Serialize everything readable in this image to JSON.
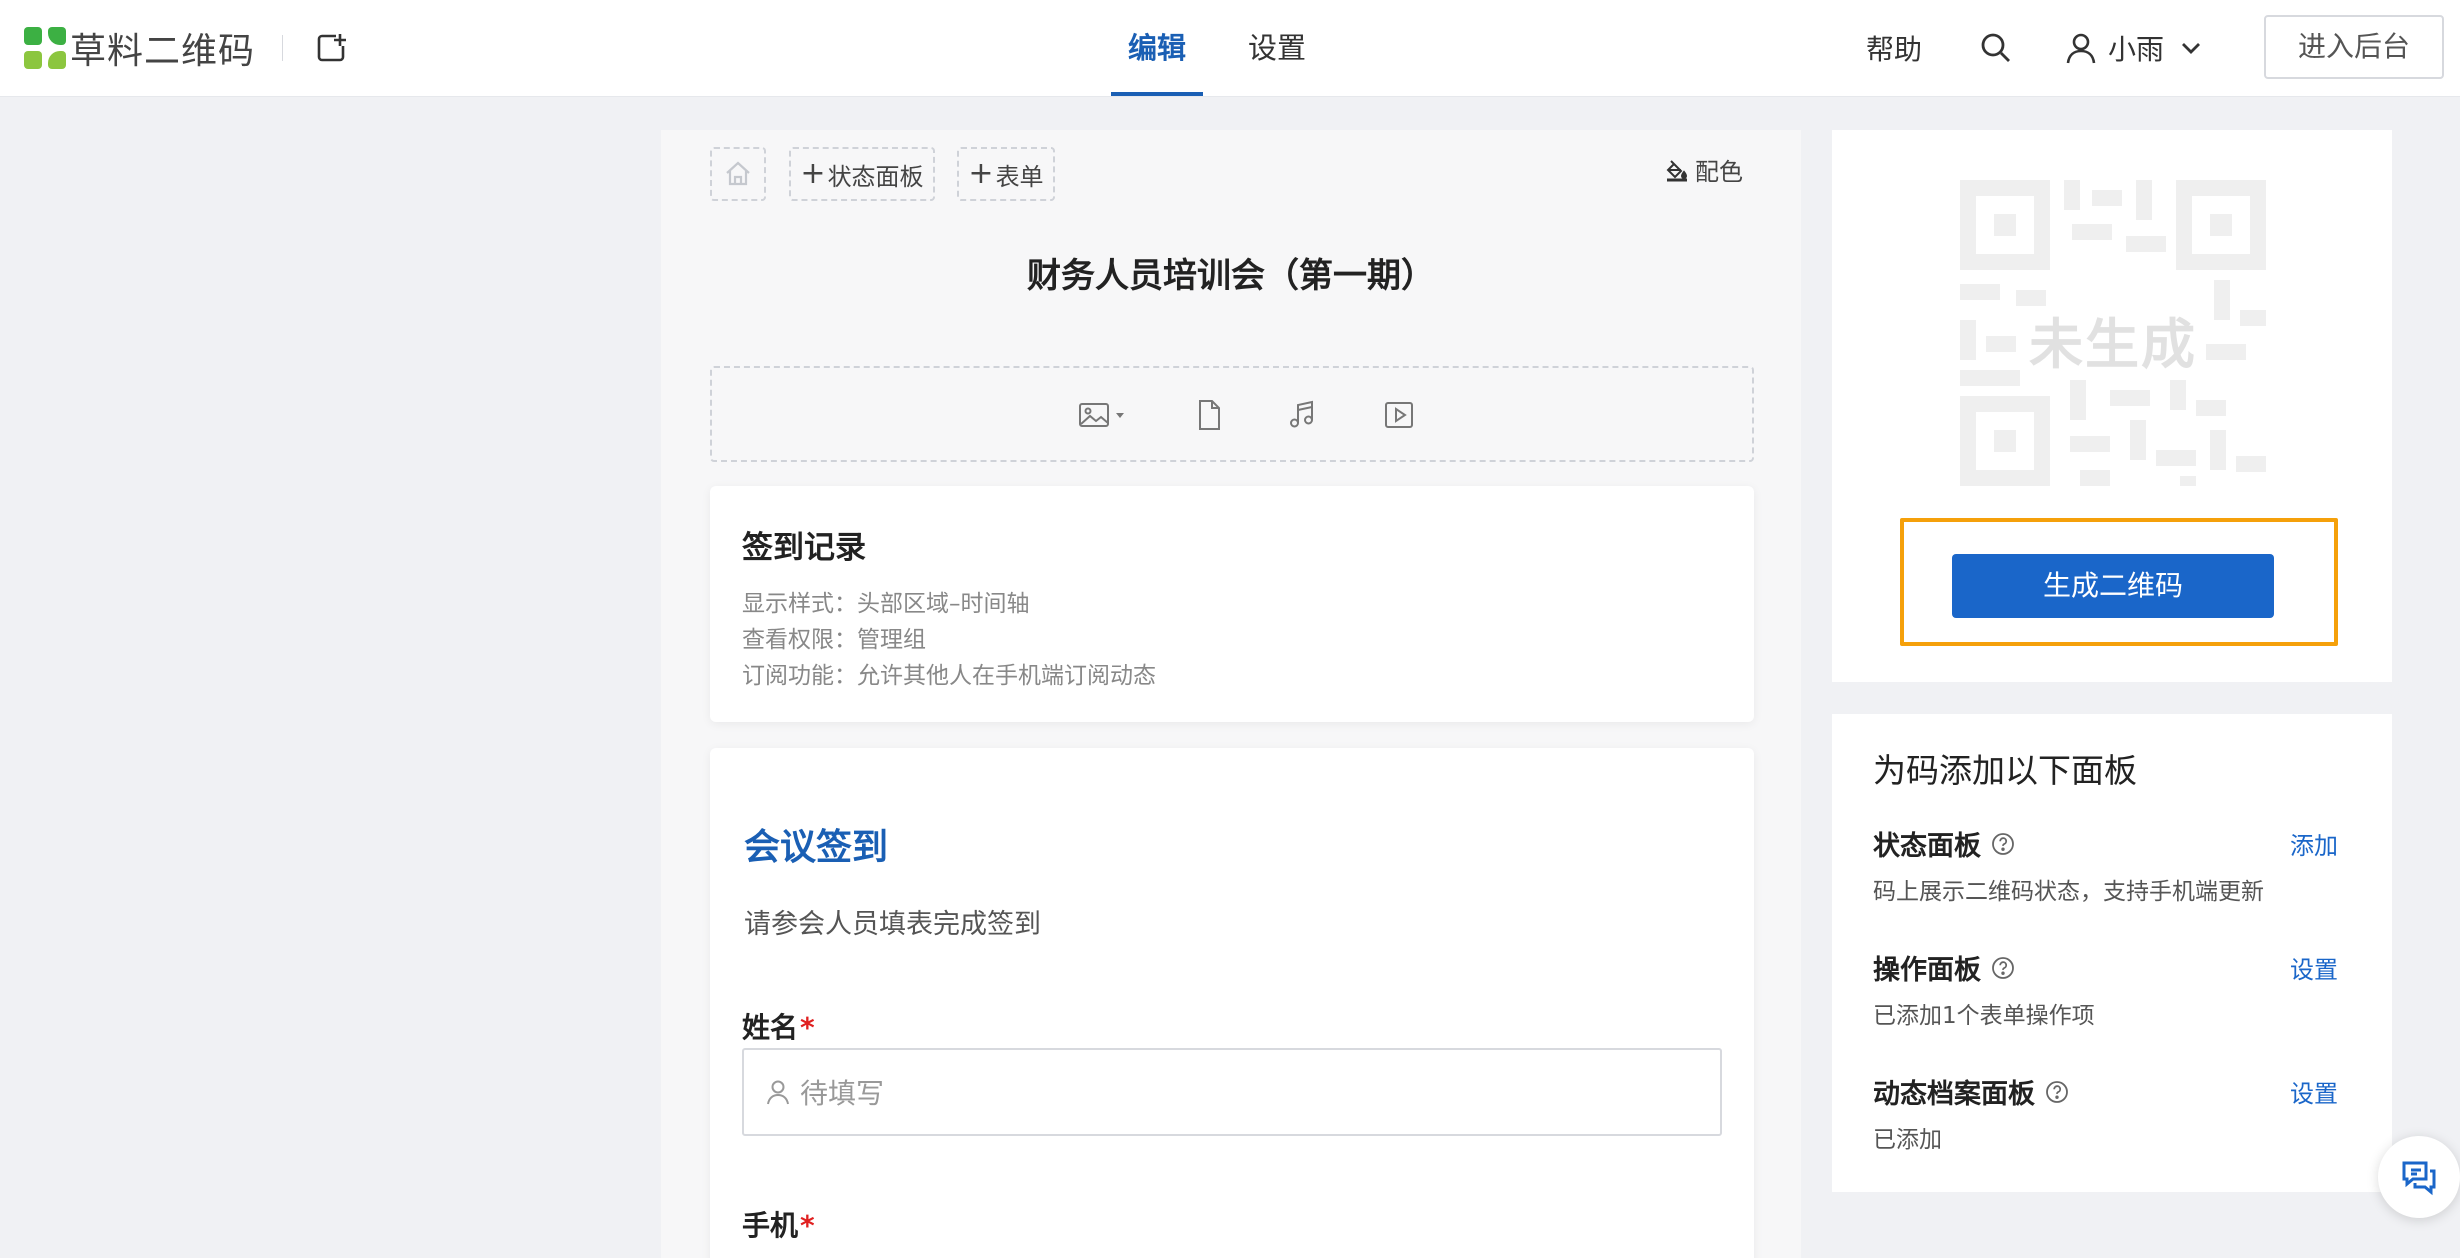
{
  "brand": {
    "name": "草料二维码"
  },
  "nav": {
    "tabs": [
      {
        "label": "编辑",
        "active": true
      },
      {
        "label": "设置",
        "active": false
      }
    ]
  },
  "header": {
    "help": "帮助",
    "user_name": "小雨",
    "backend_button": "进入后台"
  },
  "editor": {
    "chips": {
      "status_panel": "状态面板",
      "form": "表单"
    },
    "palette_label": "配色",
    "title": "财务人员培训会（第一期）",
    "media_icons": [
      "image-icon",
      "file-icon",
      "music-icon",
      "video-icon"
    ],
    "signin_record": {
      "title": "签到记录",
      "lines": [
        "显示样式：头部区域–时间轴",
        "查看权限：管理组",
        "订阅功能：允许其他人在手机端订阅动态"
      ]
    },
    "form": {
      "title": "会议签到",
      "description": "请参会人员填表完成签到",
      "fields": [
        {
          "label": "姓名",
          "required_mark": "*",
          "placeholder": "待填写"
        },
        {
          "label": "手机",
          "required_mark": "*"
        }
      ]
    }
  },
  "qr": {
    "status_text": "未生成",
    "generate_button": "生成二维码"
  },
  "panels": {
    "heading": "为码添加以下面板",
    "items": [
      {
        "title": "状态面板",
        "action": "添加",
        "desc": "码上展示二维码状态，支持手机端更新"
      },
      {
        "title": "操作面板",
        "action": "设置",
        "desc": "已添加1个表单操作项"
      },
      {
        "title": "动态档案面板",
        "action": "设置",
        "desc": "已添加"
      }
    ]
  },
  "colors": {
    "accent": "#1a5fb4",
    "button": "#1a66c9",
    "highlight": "#f5a00a",
    "required": "#e02020"
  }
}
